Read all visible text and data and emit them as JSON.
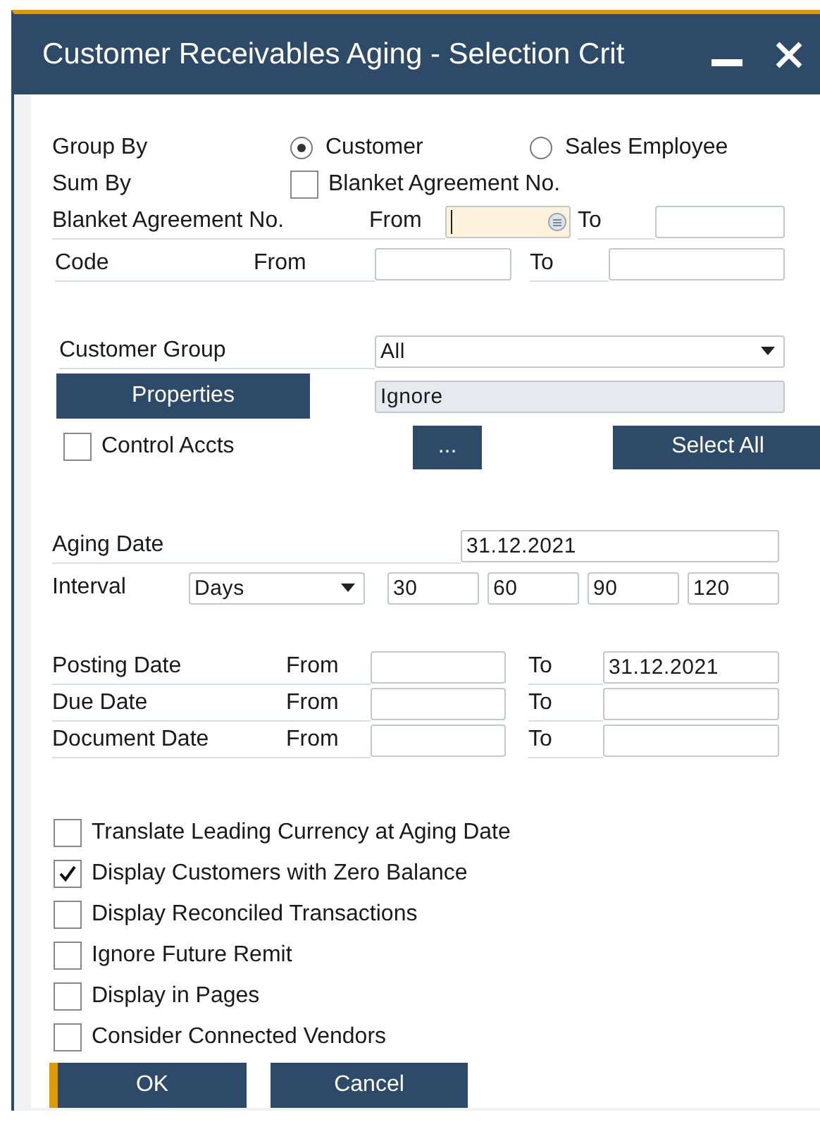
{
  "window": {
    "title": "Customer Receivables Aging - Selection Crit"
  },
  "group_by": {
    "label": "Group By",
    "options": [
      {
        "label": "Customer",
        "selected": true
      },
      {
        "label": "Sales Employee",
        "selected": false
      }
    ]
  },
  "sum_by": {
    "label": "Sum By",
    "option": {
      "label": "Blanket Agreement No.",
      "checked": false
    }
  },
  "blanket_range": {
    "label": "Blanket Agreement No.",
    "from_label": "From",
    "to_label": "To",
    "from_focused": true
  },
  "code_range": {
    "label": "Code",
    "from_label": "From",
    "to_label": "To"
  },
  "customer_group": {
    "label": "Customer Group",
    "value": "All"
  },
  "properties": {
    "button": "Properties",
    "value": "Ignore"
  },
  "control_accts": {
    "label": "Control Accts",
    "checked": false
  },
  "more_button": "...",
  "select_all_button": "Select All",
  "aging_date": {
    "label": "Aging Date",
    "value": "31.12.2021"
  },
  "interval": {
    "label": "Interval",
    "unit": "Days",
    "values": [
      "30",
      "60",
      "90",
      "120"
    ]
  },
  "date_ranges": [
    {
      "label": "Posting Date",
      "from_label": "From",
      "to_label": "To",
      "to": "31.12.2021"
    },
    {
      "label": "Due Date",
      "from_label": "From",
      "to_label": "To"
    },
    {
      "label": "Document Date",
      "from_label": "From",
      "to_label": "To"
    }
  ],
  "options": [
    {
      "label": "Translate Leading Currency at Aging Date",
      "checked": false
    },
    {
      "label": "Display Customers with Zero Balance",
      "checked": true
    },
    {
      "label": "Display Reconciled Transactions",
      "checked": false
    },
    {
      "label": "Ignore Future Remit",
      "checked": false
    },
    {
      "label": "Display in Pages",
      "checked": false
    },
    {
      "label": "Consider Connected Vendors",
      "checked": false
    }
  ],
  "buttons": [
    {
      "label": "OK",
      "default": true
    },
    {
      "label": "Cancel",
      "default": false
    }
  ]
}
